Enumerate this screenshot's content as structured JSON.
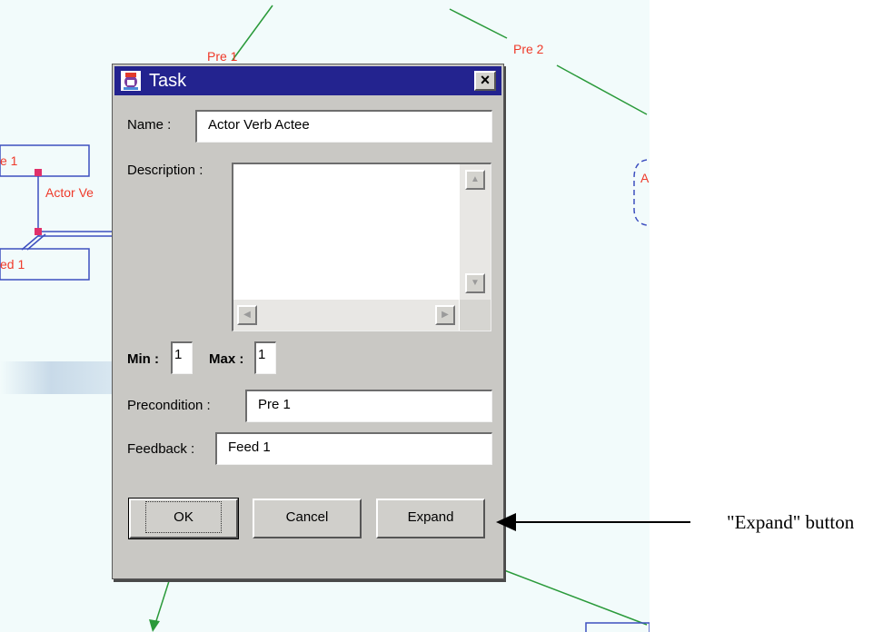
{
  "background_diagram": {
    "labels": {
      "pre1": "Pre 1",
      "pre2": "Pre 2",
      "left_top": "e 1",
      "left_mid": "Actor Ve",
      "left_bottom": "ed 1",
      "right_partial": "A"
    },
    "colors": {
      "label": "#ef3a2a",
      "edge": "#2a9a3a",
      "box": "#3d4fc0"
    }
  },
  "dialog": {
    "title": "Task",
    "icon": "task-app-icon",
    "close_label": "×",
    "name_label": "Name :",
    "name_value": "Actor Verb Actee",
    "description_label": "Description :",
    "description_value": "",
    "min_label": "Min :",
    "min_value": "1",
    "max_label": "Max :",
    "max_value": "1",
    "precondition_label": "Precondition :",
    "precondition_value": "Pre 1",
    "feedback_label": "Feedback :",
    "feedback_value": "Feed 1",
    "buttons": {
      "ok": "OK",
      "cancel": "Cancel",
      "expand": "Expand"
    },
    "colors": {
      "titlebar": "#23238f",
      "panel": "#c9c8c4"
    }
  },
  "annotation": {
    "text": "\"Expand\" button"
  }
}
